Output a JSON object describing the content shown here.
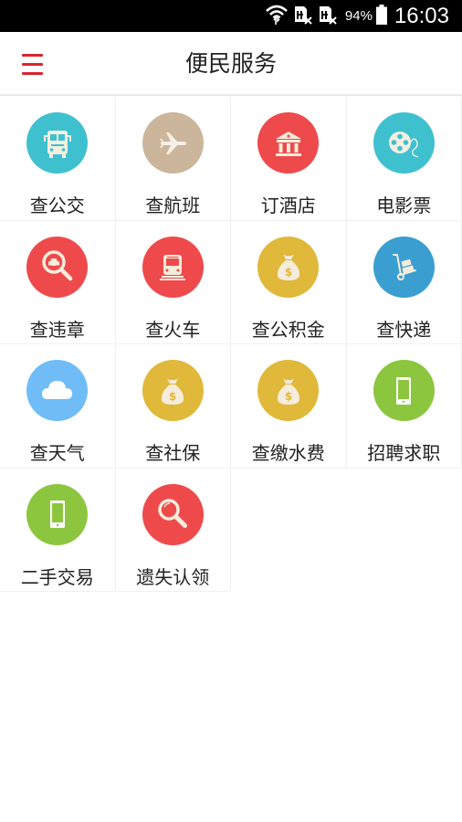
{
  "status_bar": {
    "icons": [
      "wifi-icon",
      "sim1-no-signal-icon",
      "sim2-no-signal-icon",
      "battery-icon"
    ],
    "battery_percent": "94%",
    "time": "16:03"
  },
  "app_bar": {
    "menu_icon": "hamburger-menu-icon",
    "title": "便民服务"
  },
  "services": [
    {
      "label": "查公交",
      "icon": "bus-icon",
      "color": "#3fc0cf"
    },
    {
      "label": "查航班",
      "icon": "airplane-icon",
      "color": "#cbb59b"
    },
    {
      "label": "订酒店",
      "icon": "hotel-building-icon",
      "color": "#ee4a4c"
    },
    {
      "label": "电影票",
      "icon": "film-reel-icon",
      "color": "#3fc0cf"
    },
    {
      "label": "查违章",
      "icon": "car-search-icon",
      "color": "#ee4a4c"
    },
    {
      "label": "查火车",
      "icon": "train-icon",
      "color": "#ee4a4c"
    },
    {
      "label": "查公积金",
      "icon": "money-bag-icon",
      "color": "#e0b83a"
    },
    {
      "label": "查快递",
      "icon": "hand-truck-icon",
      "color": "#3a9fd0"
    },
    {
      "label": "查天气",
      "icon": "cloud-icon",
      "color": "#6fbcf7"
    },
    {
      "label": "查社保",
      "icon": "money-bag-icon",
      "color": "#e0b83a"
    },
    {
      "label": "查缴水费",
      "icon": "money-bag-icon",
      "color": "#e0b83a"
    },
    {
      "label": "招聘求职",
      "icon": "smartphone-icon",
      "color": "#8cc63f"
    },
    {
      "label": "二手交易",
      "icon": "smartphone-icon",
      "color": "#8cc63f"
    },
    {
      "label": "遗失认领",
      "icon": "magnifier-icon",
      "color": "#ee4a4c"
    }
  ]
}
